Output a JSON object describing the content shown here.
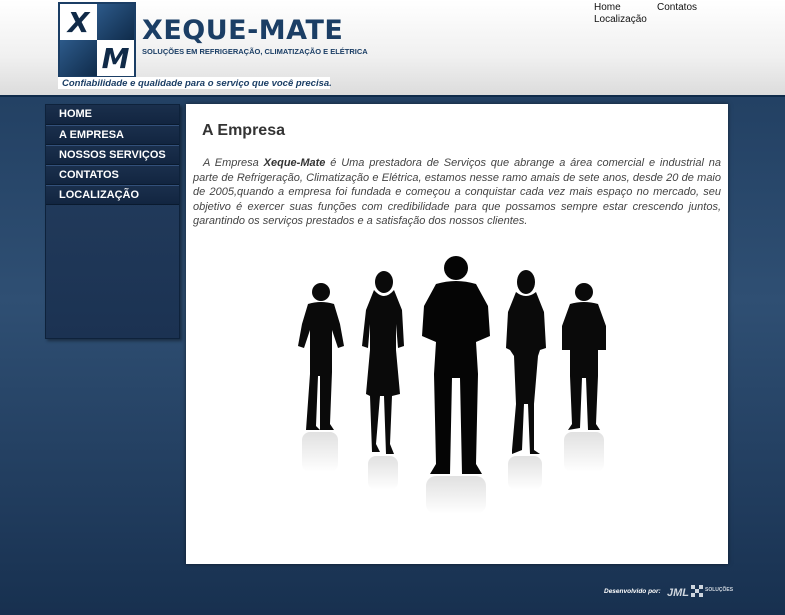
{
  "header": {
    "logo_letters": [
      "X",
      "",
      "",
      "M"
    ],
    "brand_name": "XEQUE-MATE",
    "brand_subtitle": "SOLUÇÕES EM REFRIGERAÇÃO, CLIMATIZAÇÃO E ELÉTRICA",
    "tagline": "Confiabilidade e qualidade para o serviço que você precisa.",
    "colors": {
      "brand": "#1b3e65",
      "dark_bg": "#1d3a5c"
    }
  },
  "top_nav": {
    "home": "Home",
    "contatos": "Contatos",
    "localizacao": "Localização"
  },
  "sidebar": {
    "items": [
      {
        "label": "HOME"
      },
      {
        "label": "A EMPRESA"
      },
      {
        "label": "NOSSOS SERVIÇOS"
      },
      {
        "label": "CONTATOS"
      },
      {
        "label": "LOCALIZAÇÃO"
      }
    ]
  },
  "main": {
    "title": "A Empresa",
    "paragraph_intro": "A Empresa ",
    "company_name": "Xeque-Mate",
    "paragraph_body": " é Uma prestadora de Serviços que abrange a área comercial e        industrial na parte de Refrigeração, Climatização e Elétrica, estamos nesse ramo amais de  sete anos, desde 20 de maio de 2005,quando a empresa foi fundada e começou a conquistar cada vez mais espaço no mercado, seu objetivo é exercer suas funções com credibilidade para que possamos sempre estar crescendo juntos, garantindo os serviços prestados e a satisfação dos nossos clientes.",
    "image_icon": "business-people-silhouettes"
  },
  "footer": {
    "credit_label": "Desenvolvido por:",
    "credit_logo_text": "JML",
    "credit_logo_sub": "SOLUÇÕES"
  }
}
